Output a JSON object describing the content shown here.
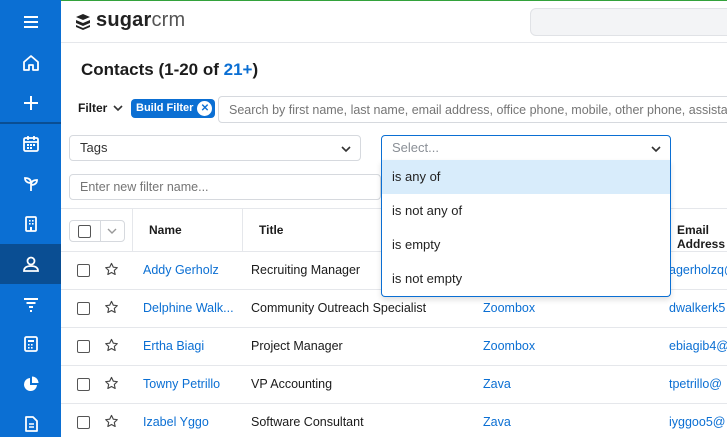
{
  "logo": {
    "bold": "sugar",
    "light": "crm"
  },
  "sidebar": {
    "items": [
      "menu-icon",
      "home-icon",
      "plus-icon",
      "calendar-icon",
      "plant-icon",
      "building-icon",
      "contacts-icon",
      "funnel-icon",
      "calculator-icon",
      "pie-chart-icon",
      "document-icon"
    ]
  },
  "page": {
    "title_prefix": "Contacts (1-20 of ",
    "count": "21+",
    "title_suffix": ")"
  },
  "filter": {
    "label": "Filter",
    "build_filter": "Build Filter",
    "search_placeholder": "Search by first name, last name, email address, office phone, mobile, other phone, assistant",
    "field_value": "Tags",
    "operator_placeholder": "Select...",
    "filter_name_placeholder": "Enter new filter name...",
    "operator_options": [
      "is any of",
      "is not any of",
      "is empty",
      "is not empty"
    ]
  },
  "table": {
    "columns": {
      "name": "Name",
      "title": "Title",
      "email": "Email Address"
    },
    "rows": [
      {
        "name": "Addy Gerholz",
        "title": "Recruiting Manager",
        "account": "",
        "email": "agerholzq@"
      },
      {
        "name": "Delphine Walk...",
        "title": "Community Outreach Specialist",
        "account": "Zoombox",
        "email": "dwalkerk5"
      },
      {
        "name": "Ertha Biagi",
        "title": "Project Manager",
        "account": "Zoombox",
        "email": "ebiagib4@"
      },
      {
        "name": "Towny Petrillo",
        "title": "VP Accounting",
        "account": "Zava",
        "email": "tpetrillo@"
      },
      {
        "name": "Izabel Yggo",
        "title": "Software Consultant",
        "account": "Zava",
        "email": "iyggoo5@"
      }
    ]
  },
  "colors": {
    "brand": "#0b6fd3",
    "sidebar_active": "#0a4e93",
    "highlight": "#d8ecfb"
  }
}
